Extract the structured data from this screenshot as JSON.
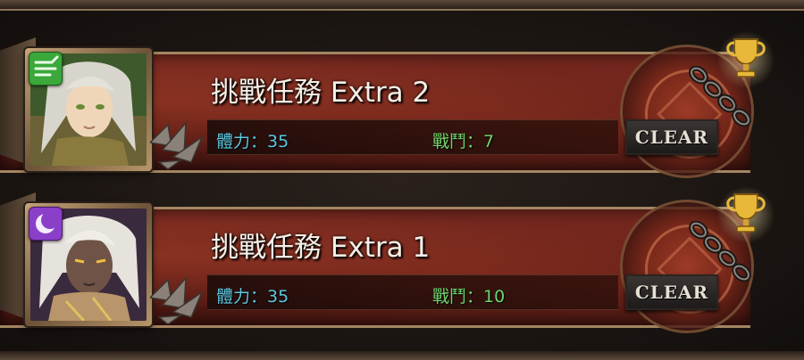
{
  "screen": {
    "missions": [
      {
        "title": "挑戰任務 Extra 2",
        "stamina": "體力：35",
        "battles": "戰鬥：7",
        "status": "CLEAR",
        "attribute": "wind-icon",
        "attribute_color": "#3aa83a",
        "portrait": "elf-archer-portrait"
      },
      {
        "title": "挑戰任務 Extra 1",
        "stamina": "體力：35",
        "battles": "戰鬥：10",
        "status": "CLEAR",
        "attribute": "moon-icon",
        "attribute_color": "#8a3fc9",
        "portrait": "dark-warrior-portrait"
      }
    ],
    "colors": {
      "banner": "#6b2219",
      "stamina_text": "#5cc7e0",
      "battles_text": "#6fd46a",
      "title_text": "#f4efe6",
      "frame_gold": "#a38662"
    }
  }
}
